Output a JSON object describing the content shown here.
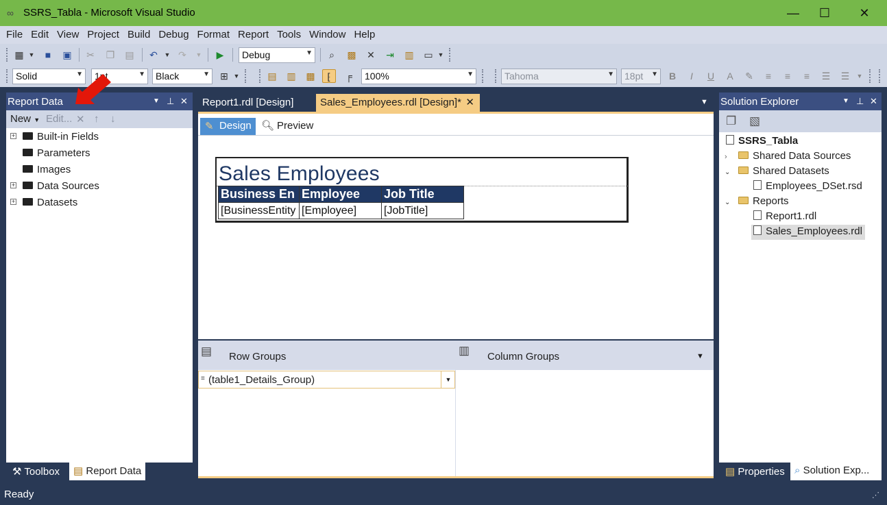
{
  "window": {
    "title": "SSRS_Tabla - Microsoft Visual Studio",
    "minimize": "—",
    "maximize": "☐",
    "close": "✕"
  },
  "menu": [
    "File",
    "Edit",
    "View",
    "Project",
    "Build",
    "Debug",
    "Format",
    "Report",
    "Tools",
    "Window",
    "Help"
  ],
  "toolbar1": {
    "config": "Debug"
  },
  "toolbar2": {
    "border_style": "Solid",
    "border_width": "1pt",
    "border_color": "Black",
    "zoom": "100%",
    "font": "Tahoma",
    "font_size": "18pt"
  },
  "report_data": {
    "title": "Report Data",
    "new_label": "New",
    "edit_label": "Edit...",
    "items": [
      {
        "label": "Built-in Fields",
        "expandable": true
      },
      {
        "label": "Parameters",
        "expandable": false
      },
      {
        "label": "Images",
        "expandable": false
      },
      {
        "label": "Data Sources",
        "expandable": true
      },
      {
        "label": "Datasets",
        "expandable": true
      }
    ],
    "bottom_tabs": [
      "Toolbox",
      "Report Data"
    ]
  },
  "doc_tabs": [
    {
      "label": "Report1.rdl [Design]",
      "active": false
    },
    {
      "label": "Sales_Employees.rdl [Design]*",
      "active": true
    }
  ],
  "designer": {
    "tabs": [
      "Design",
      "Preview"
    ],
    "report_title": "Sales  Employees",
    "table": {
      "headers": [
        "Business En",
        "Employee",
        "Job Title"
      ],
      "details": [
        "[BusinessEntity",
        "[Employee]",
        "[JobTitle]"
      ]
    }
  },
  "groups": {
    "row_groups_label": "Row Groups",
    "column_groups_label": "Column Groups",
    "row_group_item": "(table1_Details_Group)"
  },
  "solution": {
    "title": "Solution Explorer",
    "project": "SSRS_Tabla",
    "nodes": {
      "shared_data_sources": "Shared Data Sources",
      "shared_datasets": "Shared Datasets",
      "dataset_file": "Employees_DSet.rsd",
      "reports": "Reports",
      "report1": "Report1.rdl",
      "report2": "Sales_Employees.rdl"
    },
    "bottom_tabs": [
      "Properties",
      "Solution Exp..."
    ]
  },
  "status": "Ready",
  "colors": {
    "titlebar": "#76b84a",
    "chrome": "#293955",
    "panel_header": "#3b4f81",
    "active_tab": "#f5cc84",
    "table_header": "#1f3864",
    "arrow": "#e3170a"
  }
}
